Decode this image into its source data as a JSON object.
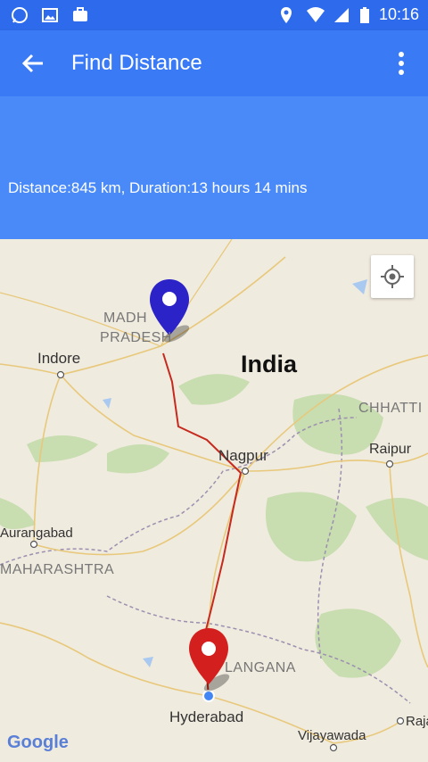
{
  "status_bar": {
    "time": "10:16",
    "icons": [
      "whatsapp-icon",
      "gallery-icon",
      "briefcase-icon",
      "location-icon",
      "wifi-icon",
      "signal-icon",
      "battery-icon"
    ]
  },
  "app_bar": {
    "title": "Find Distance",
    "back_icon": "arrow-left-icon",
    "menu_icon": "more-vert-icon"
  },
  "info": {
    "distance_text": "Distance:845 km, Duration:13 hours 14 mins"
  },
  "map": {
    "labels": {
      "country": "India",
      "madhya_line1": "MADH",
      "madhya_line2": "PRADESH",
      "indore": "Indore",
      "nagpur": "Nagpur",
      "chhattisgarh": "CHHATTI",
      "raipur": "Raipur",
      "aurangabad": "Aurangabad",
      "maharashtra": "MAHARASHTRA",
      "telangana": "LANGANA",
      "hyderabad": "Hyderabad",
      "vijayawada": "Vijayawada",
      "raja": "Raja"
    },
    "logo": "Google",
    "colors": {
      "start_marker": "#2b23c8",
      "end_marker": "#d3201f",
      "route": "#c62a1e"
    }
  }
}
